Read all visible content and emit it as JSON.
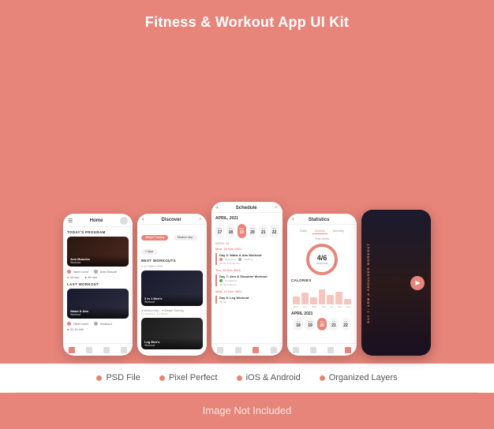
{
  "title": "Fitness & Workout App UI Kit",
  "phones": [
    {
      "id": "home",
      "header": "Home",
      "sections": [
        {
          "label": "TODAY'S PROGRAM",
          "card_title": "Arm Muscles",
          "card_sub": "Workout"
        },
        {
          "label": "LAST WORKOUT",
          "card_title": "Waist & Abs",
          "card_sub": "Workout"
        }
      ]
    },
    {
      "id": "discover",
      "header": "Discover",
      "section_label": "BEST WORKOUTS",
      "tags": [
        "Weight Training",
        "Medium dep.",
        "7 days"
      ],
      "cards": [
        "3 in 1 Men's Workout",
        "Leg Men's Workout"
      ]
    },
    {
      "id": "schedule",
      "header": "Schedule",
      "month": "APRIL, 2021",
      "dates": [
        "17",
        "18",
        "19",
        "20",
        "21",
        "22"
      ],
      "active_date": "19",
      "week_label": "WEEK 28",
      "items": [
        "Day 6: Waist & Abs Workout",
        "Day 7: Arm & Shoulder Workout",
        "Day 8: Leg Workout"
      ]
    },
    {
      "id": "statistics",
      "header": "Statistics",
      "tabs": [
        "Daily",
        "Weekly",
        "Monthly"
      ],
      "active_tab": "Weekly",
      "this_week_label": "This week",
      "workouts_fraction": "4/6",
      "workouts_label": "Workouts",
      "calories_label": "CALORIES",
      "chart_days": [
        "Mon",
        "Tue",
        "Wed",
        "Thu",
        "Fri",
        "Sat",
        "Sun"
      ],
      "chart_values": [
        40,
        60,
        35,
        75,
        50,
        65,
        30
      ]
    },
    {
      "id": "dark",
      "workout_text": "Day 7: Arm & Shoulder Workout"
    }
  ],
  "features": [
    "PSD File",
    "Pixel Perfect",
    "iOS & Android",
    "Organized Layers"
  ],
  "footer_text": "Image Not Included"
}
